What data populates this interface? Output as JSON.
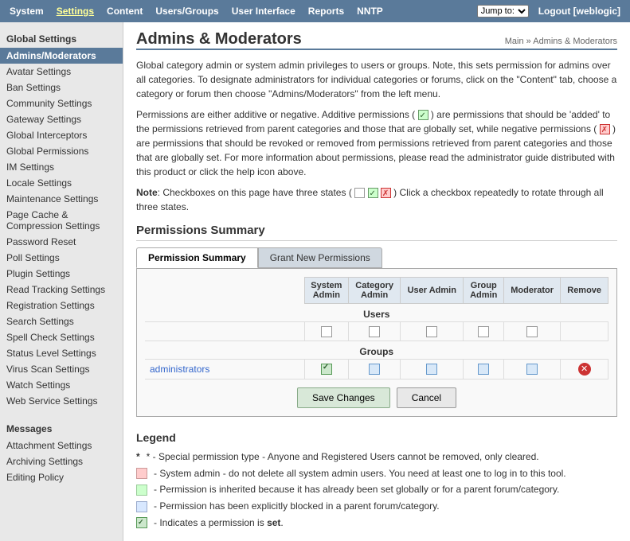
{
  "topnav": {
    "items": [
      {
        "label": "System",
        "active": false
      },
      {
        "label": "Settings",
        "active": true
      },
      {
        "label": "Content",
        "active": false
      },
      {
        "label": "Users/Groups",
        "active": false
      },
      {
        "label": "User Interface",
        "active": false
      },
      {
        "label": "Reports",
        "active": false
      },
      {
        "label": "NNTP",
        "active": false
      }
    ],
    "jump_placeholder": "Jump to:",
    "logout_label": "Logout [weblogic]"
  },
  "sidebar": {
    "global_settings_title": "Global Settings",
    "items": [
      {
        "label": "Admins/Moderators",
        "active": true
      },
      {
        "label": "Avatar Settings",
        "active": false
      },
      {
        "label": "Ban Settings",
        "active": false
      },
      {
        "label": "Community Settings",
        "active": false
      },
      {
        "label": "Gateway Settings",
        "active": false
      },
      {
        "label": "Global Interceptors",
        "active": false
      },
      {
        "label": "Global Permissions",
        "active": false
      },
      {
        "label": "IM Settings",
        "active": false
      },
      {
        "label": "Locale Settings",
        "active": false
      },
      {
        "label": "Maintenance Settings",
        "active": false
      },
      {
        "label": "Page Cache & Compression Settings",
        "active": false
      },
      {
        "label": "Password Reset",
        "active": false
      },
      {
        "label": "Poll Settings",
        "active": false
      },
      {
        "label": "Plugin Settings",
        "active": false
      },
      {
        "label": "Read Tracking Settings",
        "active": false
      },
      {
        "label": "Registration Settings",
        "active": false
      },
      {
        "label": "Search Settings",
        "active": false
      },
      {
        "label": "Spell Check Settings",
        "active": false
      },
      {
        "label": "Status Level Settings",
        "active": false
      },
      {
        "label": "Virus Scan Settings",
        "active": false
      },
      {
        "label": "Watch Settings",
        "active": false
      },
      {
        "label": "Web Service Settings",
        "active": false
      }
    ],
    "messages_title": "Messages",
    "messages_items": [
      {
        "label": "Attachment Settings",
        "active": false
      },
      {
        "label": "Archiving Settings",
        "active": false
      },
      {
        "label": "Editing Policy",
        "active": false
      }
    ]
  },
  "main": {
    "page_title": "Admins & Moderators",
    "breadcrumb": "Main » Admins & Moderators",
    "intro1": "Global category admin or system admin privileges to users or groups. Note, this sets permission for admins over all categories. To designate administrators for individual categories or forums, click on the \"Content\" tab, choose a category or forum then choose \"Admins/Moderators\" from the left menu.",
    "intro2": "Permissions are either additive or negative. Additive permissions ( ☑ ) are permissions that should be 'added' to the permissions retrieved from parent categories and those that are globally set, while negative permissions ( ☒ ) are permissions that should be revoked or removed from permissions retrieved from parent categories and those that are globally set. For more information about permissions, please read the administrator guide distributed with this product or click the help icon above.",
    "note": "Note: Checkboxes on this page have three states ( □ ☑ ☒ ) Click a checkbox repeatedly to rotate through all three states.",
    "permissions_summary_title": "Permissions Summary",
    "tabs": [
      {
        "label": "Permission Summary",
        "active": true
      },
      {
        "label": "Grant New Permissions",
        "active": false
      }
    ],
    "table": {
      "headers": [
        "",
        "System Admin",
        "Category Admin",
        "User Admin",
        "Group Admin",
        "Moderator",
        "Remove"
      ],
      "users_label": "Users",
      "users_row": {
        "name": "",
        "system": false,
        "category": false,
        "user": false,
        "group": false,
        "moderator": false
      },
      "groups_label": "Groups",
      "groups_rows": [
        {
          "name": "administrators",
          "system": true,
          "category": false,
          "user": false,
          "group": false,
          "moderator": false,
          "has_remove": true
        }
      ]
    },
    "save_label": "Save Changes",
    "cancel_label": "Cancel",
    "legend_title": "Legend",
    "legend_items": [
      {
        "type": "star",
        "text": "* - Special permission type - Anyone and Registered Users cannot be removed, only cleared."
      },
      {
        "type": "pink",
        "text": "- System admin - do not delete all system admin users. You need at least one to log in to this tool."
      },
      {
        "type": "green",
        "text": "- Permission is inherited because it has already been set globally or for a parent forum/category."
      },
      {
        "type": "blue",
        "text": "- Permission has been explicitly blocked in a parent forum/category."
      },
      {
        "type": "check",
        "text": "- Indicates a permission is set."
      }
    ],
    "legend_set_label": "set"
  }
}
